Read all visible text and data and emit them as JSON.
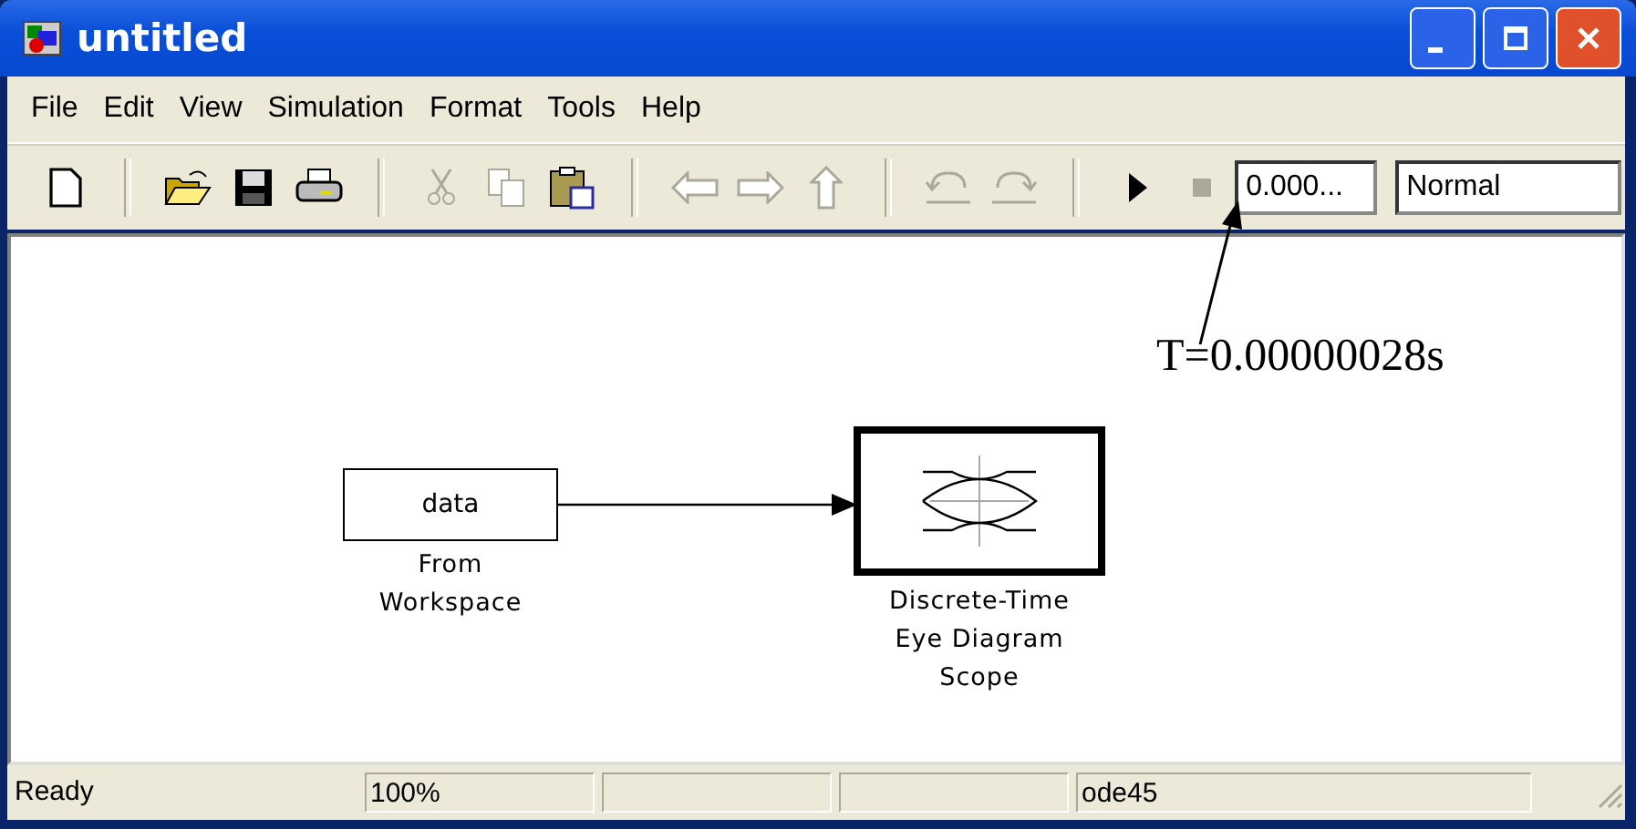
{
  "window": {
    "title": "untitled"
  },
  "menu": [
    "File",
    "Edit",
    "View",
    "Simulation",
    "Format",
    "Tools",
    "Help"
  ],
  "toolbar": [
    {
      "kind": "new",
      "disabled": false
    },
    {
      "kind": "sep"
    },
    {
      "kind": "open",
      "disabled": false
    },
    {
      "kind": "save",
      "disabled": false
    },
    {
      "kind": "print",
      "disabled": false
    },
    {
      "kind": "sep"
    },
    {
      "kind": "cut",
      "disabled": true
    },
    {
      "kind": "copy",
      "disabled": true
    },
    {
      "kind": "paste",
      "disabled": false
    },
    {
      "kind": "sep"
    },
    {
      "kind": "back",
      "disabled": true
    },
    {
      "kind": "forward",
      "disabled": true
    },
    {
      "kind": "up",
      "disabled": true
    },
    {
      "kind": "sep"
    },
    {
      "kind": "undo",
      "disabled": true
    },
    {
      "kind": "redo",
      "disabled": true
    },
    {
      "kind": "sep"
    },
    {
      "kind": "play",
      "disabled": false
    },
    {
      "kind": "stop",
      "disabled": true
    }
  ],
  "stop_time": "0.000...",
  "sim_mode": "Normal",
  "blocks": [
    {
      "kind": "source",
      "text": "data",
      "label": [
        "From",
        "Workspace"
      ]
    },
    {
      "kind": "scope",
      "label": [
        "Discrete-Time",
        "Eye Diagram",
        "Scope"
      ]
    }
  ],
  "annotation": "T=0.00000028s",
  "status_bar": {
    "message": "Ready",
    "zoom": "100%",
    "solver": "ode45"
  }
}
